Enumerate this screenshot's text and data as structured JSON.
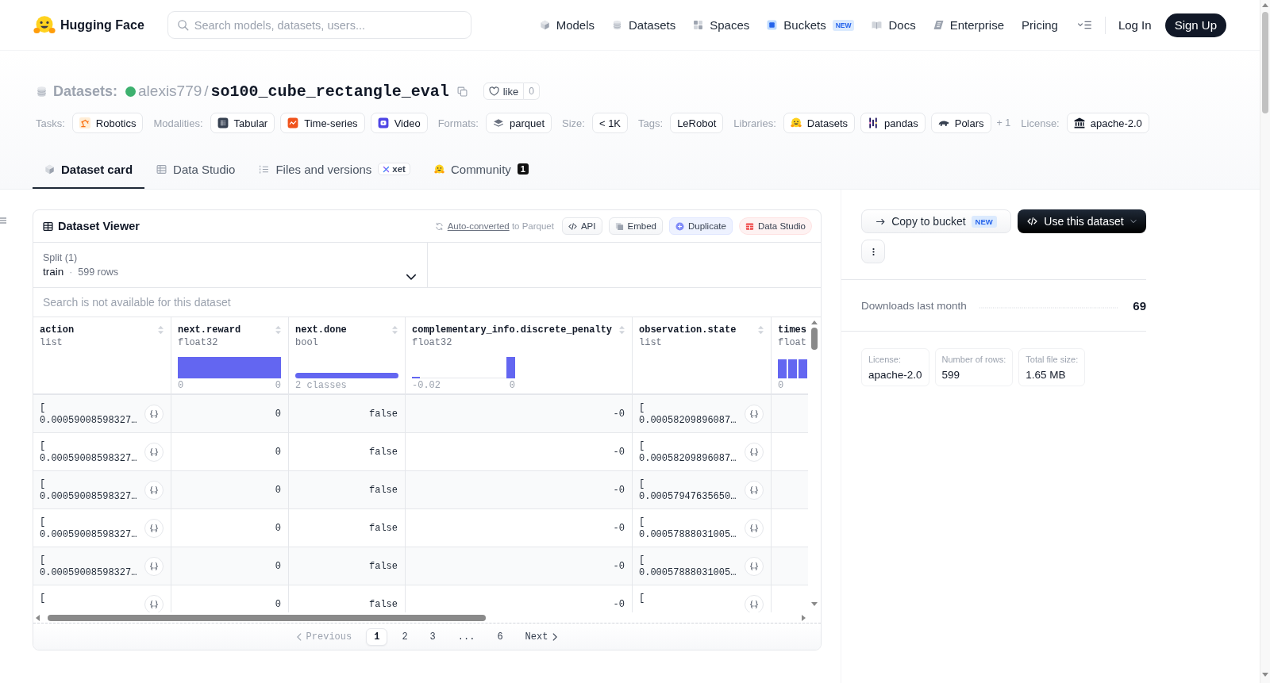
{
  "header": {
    "brand": "Hugging Face",
    "search": {
      "placeholder": "Search models, datasets, users..."
    },
    "nav": [
      {
        "label": "Models"
      },
      {
        "label": "Datasets"
      },
      {
        "label": "Spaces"
      },
      {
        "label": "Buckets",
        "badge": "NEW"
      },
      {
        "label": "Docs"
      },
      {
        "label": "Enterprise"
      },
      {
        "label": "Pricing"
      }
    ],
    "login": "Log In",
    "signup": "Sign Up"
  },
  "repo": {
    "type_label": "Datasets:",
    "owner": "alexis779",
    "separator": "/",
    "name": "so100_cube_rectangle_eval",
    "like": {
      "label": "like",
      "count": "0"
    }
  },
  "metadata": [
    {
      "label": "Tasks:",
      "chips": [
        "Robotics"
      ]
    },
    {
      "label": "Modalities:",
      "chips": [
        "Tabular",
        "Time-series",
        "Video"
      ]
    },
    {
      "label": "Formats:",
      "chips": [
        "parquet"
      ]
    },
    {
      "label": "Size:",
      "chips": [
        "< 1K"
      ]
    },
    {
      "label": "Tags:",
      "chips": [
        "LeRobot"
      ]
    },
    {
      "label": "Libraries:",
      "chips": [
        "Datasets",
        "pandas",
        "Polars"
      ],
      "more": "+ 1"
    },
    {
      "label": "License:",
      "chips": [
        "apache-2.0"
      ]
    }
  ],
  "tabs": [
    {
      "label": "Dataset card",
      "selected": true
    },
    {
      "label": "Data Studio",
      "selected": false
    },
    {
      "label": "Files and versions",
      "selected": false,
      "badge": "xet"
    },
    {
      "label": "Community",
      "selected": false,
      "count": "1"
    }
  ],
  "viewer": {
    "title": "Dataset Viewer",
    "conversion": {
      "link": "Auto-converted",
      "rest": "to Parquet"
    },
    "actions": [
      {
        "label": "API",
        "kind": "secondary"
      },
      {
        "label": "Embed",
        "kind": "secondary"
      },
      {
        "label": "Duplicate",
        "kind": "duplicate"
      },
      {
        "label": "Data Studio",
        "kind": "studio"
      }
    ],
    "split": {
      "label": "Split (1)",
      "value": "train",
      "separator": "·",
      "rows": "599 rows"
    },
    "search": {
      "placeholder": "Search is not available for this dataset"
    },
    "columns": [
      {
        "name": "action",
        "type": "list",
        "kind": "plain"
      },
      {
        "name": "next.reward",
        "type": "float32",
        "kind": "histogram",
        "range": [
          "0",
          "0"
        ]
      },
      {
        "name": "next.done",
        "type": "bool",
        "kind": "classes",
        "caption": "2 classes"
      },
      {
        "name": "complementary_info.discrete_penalty",
        "type": "float32",
        "kind": "histogram",
        "range": [
          "-0.02",
          "0"
        ]
      },
      {
        "name": "observation.state",
        "type": "list",
        "kind": "plain"
      },
      {
        "name": "times",
        "type": "float",
        "kind": "histogram",
        "range": [
          "0"
        ]
      }
    ],
    "rows": [
      {
        "cells": [
          {
            "kind": "list",
            "lines": [
              "[",
              "0.00059008598327…"
            ]
          },
          {
            "kind": "value",
            "text": "0"
          },
          {
            "kind": "value",
            "text": "false"
          },
          {
            "kind": "value",
            "text": "-0"
          },
          {
            "kind": "list",
            "lines": [
              "[",
              "0.00058209896087…"
            ]
          }
        ]
      },
      {
        "cells": [
          {
            "kind": "list",
            "lines": [
              "[",
              "0.00059008598327…"
            ]
          },
          {
            "kind": "value",
            "text": "0"
          },
          {
            "kind": "value",
            "text": "false"
          },
          {
            "kind": "value",
            "text": "-0"
          },
          {
            "kind": "list",
            "lines": [
              "[",
              "0.00058209896087…"
            ]
          }
        ]
      },
      {
        "cells": [
          {
            "kind": "list",
            "lines": [
              "[",
              "0.00059008598327…"
            ]
          },
          {
            "kind": "value",
            "text": "0"
          },
          {
            "kind": "value",
            "text": "false"
          },
          {
            "kind": "value",
            "text": "-0"
          },
          {
            "kind": "list",
            "lines": [
              "[",
              "0.00057947635650…"
            ]
          }
        ]
      },
      {
        "cells": [
          {
            "kind": "list",
            "lines": [
              "[",
              "0.00059008598327…"
            ]
          },
          {
            "kind": "value",
            "text": "0"
          },
          {
            "kind": "value",
            "text": "false"
          },
          {
            "kind": "value",
            "text": "-0"
          },
          {
            "kind": "list",
            "lines": [
              "[",
              "0.00057888031005…"
            ]
          }
        ]
      },
      {
        "cells": [
          {
            "kind": "list",
            "lines": [
              "[",
              "0.00059008598327…"
            ]
          },
          {
            "kind": "value",
            "text": "0"
          },
          {
            "kind": "value",
            "text": "false"
          },
          {
            "kind": "value",
            "text": "-0"
          },
          {
            "kind": "list",
            "lines": [
              "[",
              "0.00057888031005…"
            ]
          }
        ]
      },
      {
        "cells": [
          {
            "kind": "list",
            "lines": [
              "["
            ]
          },
          {
            "kind": "value",
            "text": "0"
          },
          {
            "kind": "value",
            "text": "false"
          },
          {
            "kind": "value",
            "text": "-0"
          },
          {
            "kind": "list",
            "lines": [
              "["
            ]
          }
        ]
      }
    ],
    "pagination": [
      {
        "kind": "prev",
        "label": "Previous",
        "selected": false,
        "disabled": true
      },
      {
        "kind": "page",
        "label": "1",
        "selected": true,
        "disabled": false
      },
      {
        "kind": "page",
        "label": "2",
        "selected": false,
        "disabled": false
      },
      {
        "kind": "page",
        "label": "3",
        "selected": false,
        "disabled": false
      },
      {
        "kind": "gap",
        "label": "...",
        "selected": false,
        "disabled": false
      },
      {
        "kind": "page",
        "label": "6",
        "selected": false,
        "disabled": false
      },
      {
        "kind": "next",
        "label": "Next",
        "selected": false,
        "disabled": false
      }
    ]
  },
  "sidebar": {
    "copy_button": {
      "label": "Copy to bucket",
      "badge": "NEW"
    },
    "use_button": {
      "label": "Use this dataset"
    },
    "downloads": {
      "label": "Downloads last month",
      "value": "69"
    },
    "stats": [
      {
        "label": "License:",
        "value": "apache-2.0"
      },
      {
        "label": "Number of rows:",
        "value": "599"
      },
      {
        "label": "Total file size:",
        "value": "1.65 MB"
      }
    ]
  }
}
